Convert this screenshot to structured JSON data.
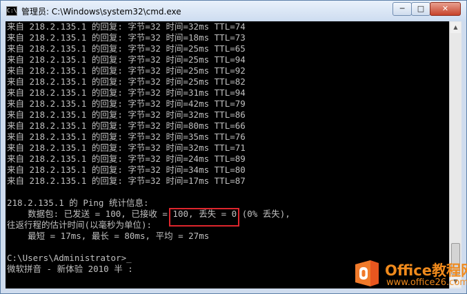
{
  "window": {
    "title": "管理员: C:\\Windows\\system32\\cmd.exe",
    "icon_label": "C:\\",
    "controls": {
      "minimize": "─",
      "maximize": "□",
      "close": "✕"
    }
  },
  "console": {
    "lines": [
      "来自 218.2.135.1 的回复: 字节=32 时间=32ms TTL=74",
      "来自 218.2.135.1 的回复: 字节=32 时间=18ms TTL=73",
      "来自 218.2.135.1 的回复: 字节=32 时间=25ms TTL=65",
      "来自 218.2.135.1 的回复: 字节=32 时间=25ms TTL=94",
      "来自 218.2.135.1 的回复: 字节=32 时间=25ms TTL=92",
      "来自 218.2.135.1 的回复: 字节=32 时间=25ms TTL=82",
      "来自 218.2.135.1 的回复: 字节=32 时间=31ms TTL=94",
      "来自 218.2.135.1 的回复: 字节=32 时间=42ms TTL=79",
      "来自 218.2.135.1 的回复: 字节=32 时间=32ms TTL=86",
      "来自 218.2.135.1 的回复: 字节=32 时间=80ms TTL=66",
      "来自 218.2.135.1 的回复: 字节=32 时间=35ms TTL=76",
      "来自 218.2.135.1 的回复: 字节=32 时间=32ms TTL=71",
      "来自 218.2.135.1 的回复: 字节=32 时间=24ms TTL=89",
      "来自 218.2.135.1 的回复: 字节=32 时间=34ms TTL=80",
      "来自 218.2.135.1 的回复: 字节=32 时间=17ms TTL=87",
      "",
      "218.2.135.1 的 Ping 统计信息:",
      "    数据包: 已发送 = 100, 已接收 = 100, 丢失 = 0 (0% 丢失),",
      "往返行程的估计时间(以毫秒为单位):",
      "    最短 = 17ms, 最长 = 80ms, 平均 = 27ms",
      "",
      "C:\\Users\\Administrator>_",
      "微软拼音 - 新体验 2010 半 :"
    ]
  },
  "watermark": {
    "brand": "Office教程网",
    "url": "www.office26.com"
  },
  "colors": {
    "console_bg": "#000000",
    "console_fg": "#c0c0c0",
    "highlight": "#e0262d",
    "watermark_orange": "#f08a1c"
  }
}
